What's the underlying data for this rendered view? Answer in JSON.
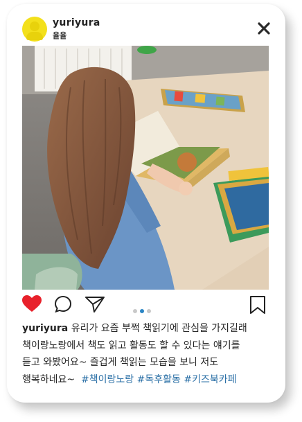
{
  "post": {
    "username": "yuriyura",
    "subtitle": "율율",
    "caption_lines": [
      "유리가 요즘 부쩍 책읽기에 관심을 가지길래",
      "책이랑노랑에서 책도 읽고 활동도 할 수 있다는 얘기를",
      "듣고 와봤어요~ 즐겁게 책읽는 모습을 보니 저도",
      "행복하네요~"
    ],
    "hashtags": [
      "#책이랑노랑",
      "#독후활동",
      "#키즈북카페"
    ],
    "carousel": {
      "count": 3,
      "active_index": 1
    },
    "liked": true
  },
  "colors": {
    "like": "#e8212b",
    "hashtag": "#2a6fa6",
    "avatar": "#f3e01c",
    "carousel_active": "#2b86c5"
  },
  "icons": [
    "user-avatar-icon",
    "close-icon",
    "heart-icon",
    "comment-icon",
    "share-icon",
    "bookmark-icon"
  ]
}
